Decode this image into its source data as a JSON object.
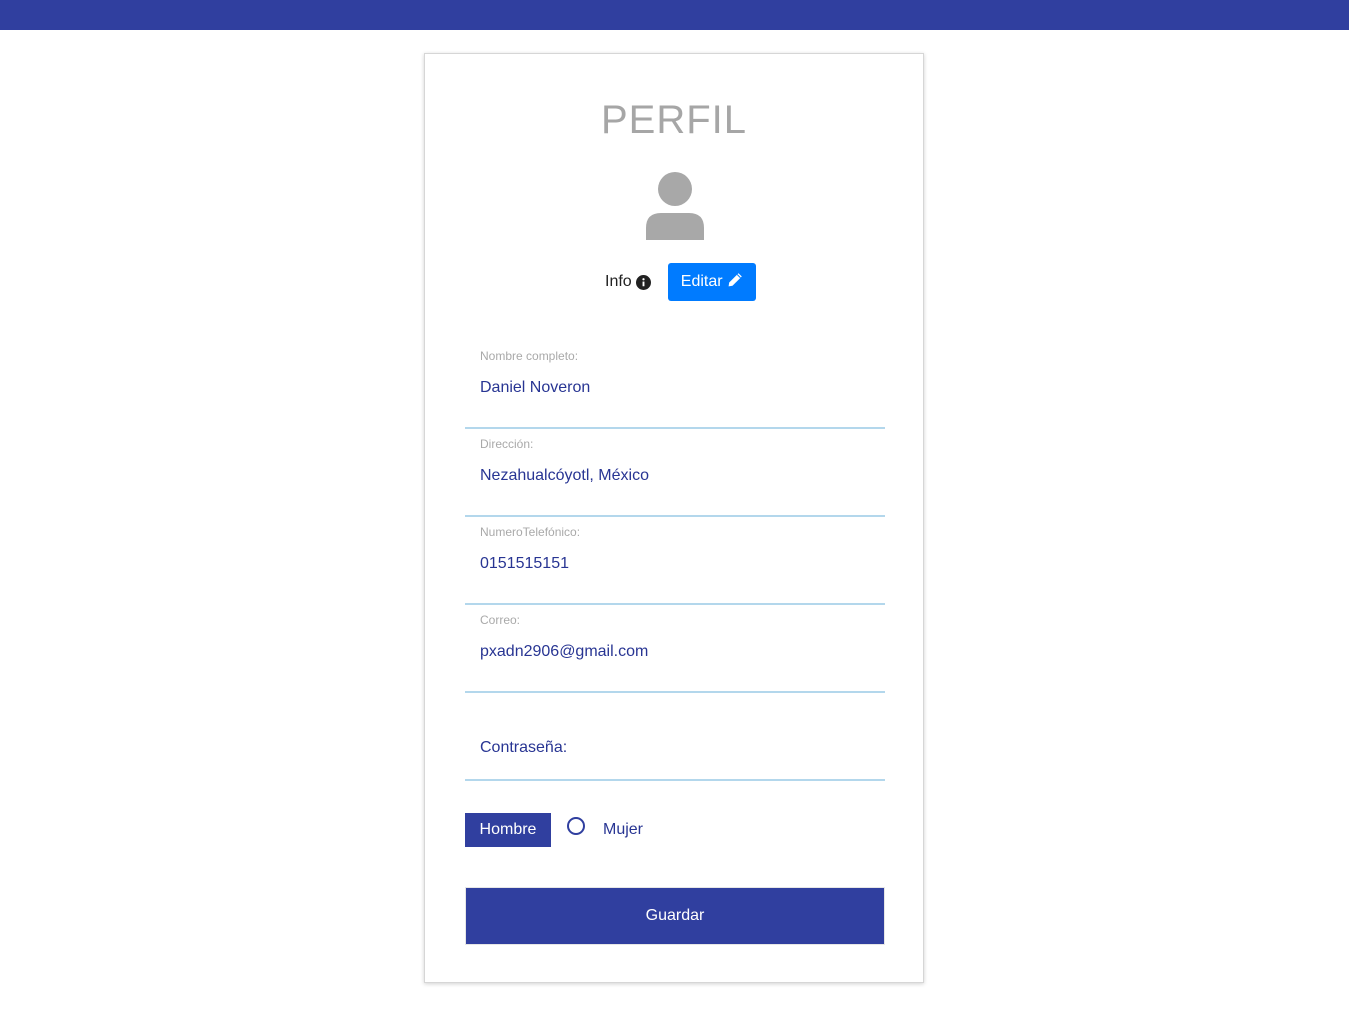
{
  "profile": {
    "title": "PERFIL",
    "info_label": "Info",
    "edit_label": "Editar"
  },
  "form": {
    "fields": [
      {
        "label": "Nombre completo:",
        "value": "Daniel Noveron"
      },
      {
        "label": "Dirección:",
        "value": "Nezahualcóyotl, México"
      },
      {
        "label": "NumeroTelefónico:",
        "value": "0151515151"
      },
      {
        "label": "Correo:",
        "value": "pxadn2906@gmail.com"
      }
    ],
    "password_placeholder": "Contraseña:",
    "gender": {
      "option_selected": "Hombre",
      "option_other": "Mujer"
    },
    "save_label": "Guardar"
  },
  "colors": {
    "header": "#303f9f",
    "accent": "#303f9f",
    "edit_button": "#007bff",
    "field_text": "#283593",
    "field_border": "#b3d7ec"
  },
  "icons": {
    "avatar": "user-icon",
    "info": "info-circle-icon",
    "edit": "pencil-icon"
  }
}
